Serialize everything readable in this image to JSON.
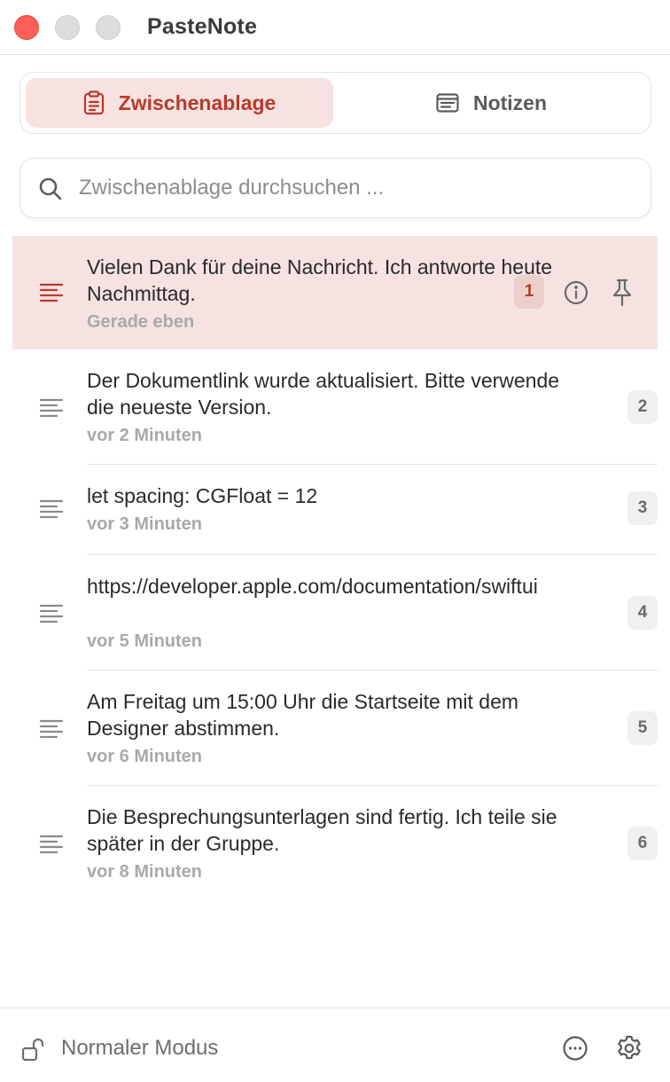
{
  "window": {
    "title": "PasteNote"
  },
  "tabs": [
    {
      "label": "Zwischenablage",
      "icon": "clipboard-icon",
      "active": true
    },
    {
      "label": "Notizen",
      "icon": "notes-icon",
      "active": false
    }
  ],
  "search": {
    "placeholder": "Zwischenablage durchsuchen ...",
    "value": ""
  },
  "items": [
    {
      "text": "Vielen Dank für deine Nachricht. Ich antworte heute Nachmittag.",
      "time": "Gerade eben",
      "index": "1",
      "selected": true
    },
    {
      "text": "Der Dokumentlink wurde aktualisiert. Bitte verwende die neueste Version.",
      "time": "vor 2 Minuten",
      "index": "2",
      "selected": false
    },
    {
      "text": "let spacing: CGFloat = 12",
      "time": "vor 3 Minuten",
      "index": "3",
      "selected": false
    },
    {
      "text": "https://developer.apple.com/documentation/swiftui",
      "time": "vor 5 Minuten",
      "index": "4",
      "selected": false
    },
    {
      "text": "Am Freitag um 15:00 Uhr die Startseite mit dem Designer abstimmen.",
      "time": "vor 6 Minuten",
      "index": "5",
      "selected": false
    },
    {
      "text": "Die Besprechungsunterlagen sind fertig. Ich teile sie später in der Gruppe.",
      "time": "vor 8 Minuten",
      "index": "6",
      "selected": false
    }
  ],
  "footer": {
    "mode_label": "Normaler Modus"
  },
  "colors": {
    "accent": "#b83a2b",
    "selection": "#f6e2e0",
    "close": "#ff5f57"
  }
}
